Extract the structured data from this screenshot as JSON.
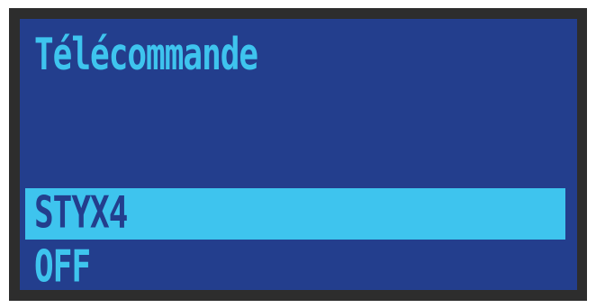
{
  "screen": {
    "title": "Télécommande",
    "menu": [
      {
        "label": "STYX4",
        "selected": true
      },
      {
        "label": "OFF",
        "selected": false
      }
    ]
  },
  "colors": {
    "bezel": "#2d2d2d",
    "background": "#233e8d",
    "text": "#3ec4ee",
    "highlight": "#3ec4ee",
    "highlight_text": "#233e8d"
  }
}
